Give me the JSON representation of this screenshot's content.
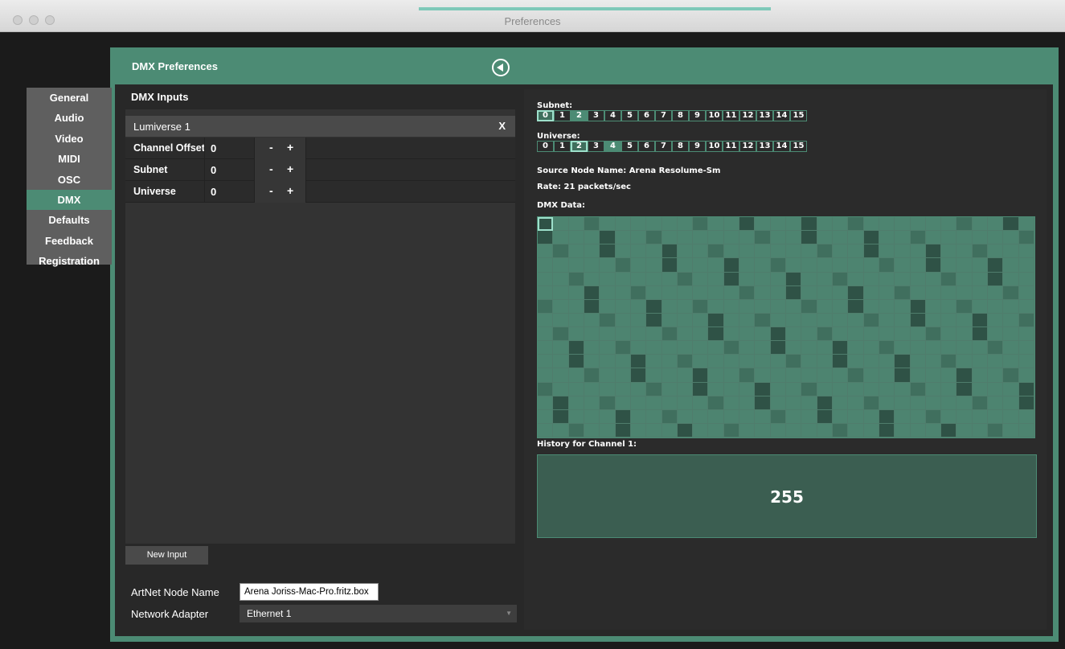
{
  "window": {
    "title": "Preferences"
  },
  "nav": {
    "items": [
      "General",
      "Audio",
      "Video",
      "MIDI",
      "OSC",
      "DMX",
      "Defaults",
      "Feedback",
      "Registration"
    ],
    "active": "DMX"
  },
  "panel": {
    "title": "DMX Preferences",
    "back_icon": "back-circle-icon"
  },
  "inputs": {
    "title": "DMX Inputs",
    "item_name": "Lumiverse 1",
    "close_label": "X",
    "rows": [
      {
        "label": "Channel Offset",
        "value": "0",
        "minus": "-",
        "plus": "+"
      },
      {
        "label": "Subnet",
        "value": "0",
        "minus": "-",
        "plus": "+"
      },
      {
        "label": "Universe",
        "value": "0",
        "minus": "-",
        "plus": "+"
      }
    ],
    "new_input_label": "New Input"
  },
  "artnet": {
    "node_name_label": "ArtNet Node Name",
    "node_name_value": "Arena Joriss-Mac-Pro.fritz.box",
    "adapter_label": "Network Adapter",
    "adapter_value": "Ethernet 1"
  },
  "monitor": {
    "subnet_label": "Subnet:",
    "universe_label": "Universe:",
    "numbers": [
      "0",
      "1",
      "2",
      "3",
      "4",
      "5",
      "6",
      "7",
      "8",
      "9",
      "10",
      "11",
      "12",
      "13",
      "14",
      "15"
    ],
    "subnet_selected": 0,
    "subnet_highlighted": [
      2
    ],
    "universe_selected": 2,
    "universe_highlighted": [
      4
    ],
    "source_node": "Source Node Name: Arena Resolume-Sm",
    "rate": "Rate: 21 packets/sec",
    "dmx_data_label": "DMX Data:",
    "history_label": "History for Channel 1:",
    "history_value": "255"
  },
  "colors": {
    "accent": "#4c8b74",
    "highlight": "#9de0cb",
    "dark_cell": "#2f5246"
  }
}
